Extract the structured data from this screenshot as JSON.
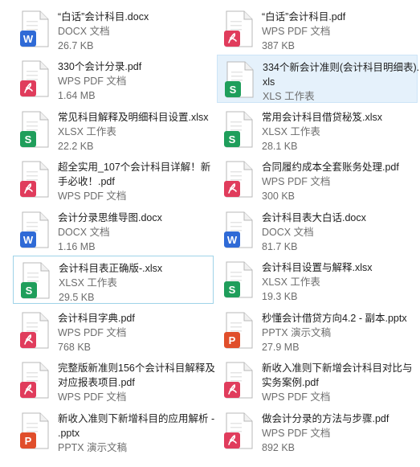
{
  "icon_colors": {
    "word": "#2f6ad6",
    "pdf": "#e03c5c",
    "excel": "#1f9e5b",
    "ppt": "#e04e2b"
  },
  "files": [
    {
      "name": "“白话”会计科目.docx",
      "type": "DOCX 文档",
      "size": "26.7 KB",
      "icon": "word-icon",
      "state": "normal"
    },
    {
      "name": "“白话”会计科目.pdf",
      "type": "WPS PDF 文档",
      "size": "387 KB",
      "icon": "pdf-icon",
      "state": "normal"
    },
    {
      "name": "330个会计分录.pdf",
      "type": "WPS PDF 文档",
      "size": "1.64 MB",
      "icon": "pdf-icon",
      "state": "normal"
    },
    {
      "name": "334个新会计准则(会计科目明细表).xls",
      "type": "XLS 工作表",
      "size": "",
      "icon": "excel-icon",
      "state": "selected"
    },
    {
      "name": "常见科目解释及明细科目设置.xlsx",
      "type": "XLSX 工作表",
      "size": "22.2 KB",
      "icon": "excel-icon",
      "state": "normal"
    },
    {
      "name": "常用会计科目借贷秘笈.xlsx",
      "type": "XLSX 工作表",
      "size": "28.1 KB",
      "icon": "excel-icon",
      "state": "normal"
    },
    {
      "name": "超全实用_107个会计科目详解！新手必收！.pdf",
      "type": "WPS PDF 文档",
      "size": "",
      "icon": "pdf-icon",
      "state": "normal"
    },
    {
      "name": "合同履约成本全套账务处理.pdf",
      "type": "WPS PDF 文档",
      "size": "300 KB",
      "icon": "pdf-icon",
      "state": "normal"
    },
    {
      "name": "会计分录思维导图.docx",
      "type": "DOCX 文档",
      "size": "1.16 MB",
      "icon": "word-icon",
      "state": "normal"
    },
    {
      "name": "会计科目表大白话.docx",
      "type": "DOCX 文档",
      "size": "81.7 KB",
      "icon": "word-icon",
      "state": "normal"
    },
    {
      "name": "会计科目表正确版-.xlsx",
      "type": "XLSX 工作表",
      "size": "29.5 KB",
      "icon": "excel-icon",
      "state": "hovered"
    },
    {
      "name": "会计科目设置与解释.xlsx",
      "type": "XLSX 工作表",
      "size": "19.3 KB",
      "icon": "excel-icon",
      "state": "normal"
    },
    {
      "name": "会计科目字典.pdf",
      "type": "WPS PDF 文档",
      "size": "768 KB",
      "icon": "pdf-icon",
      "state": "normal"
    },
    {
      "name": "秒懂会计借贷方向4.2 - 副本.pptx",
      "type": "PPTX 演示文稿",
      "size": "27.9 MB",
      "icon": "ppt-icon",
      "state": "normal"
    },
    {
      "name": "完整版新准则156个会计科目解释及对应报表项目.pdf",
      "type": "WPS PDF 文档",
      "size": "",
      "icon": "pdf-icon",
      "state": "normal"
    },
    {
      "name": "新收入准则下新增会计科目对比与实务案例.pdf",
      "type": "WPS PDF 文档",
      "size": "",
      "icon": "pdf-icon",
      "state": "normal"
    },
    {
      "name": "新收入准则下新增科目的应用解析 - .pptx",
      "type": "PPTX 演示文稿",
      "size": "",
      "icon": "ppt-icon",
      "state": "normal"
    },
    {
      "name": "做会计分录的方法与步骤.pdf",
      "type": "WPS PDF 文档",
      "size": "892 KB",
      "icon": "pdf-icon",
      "state": "normal"
    }
  ]
}
